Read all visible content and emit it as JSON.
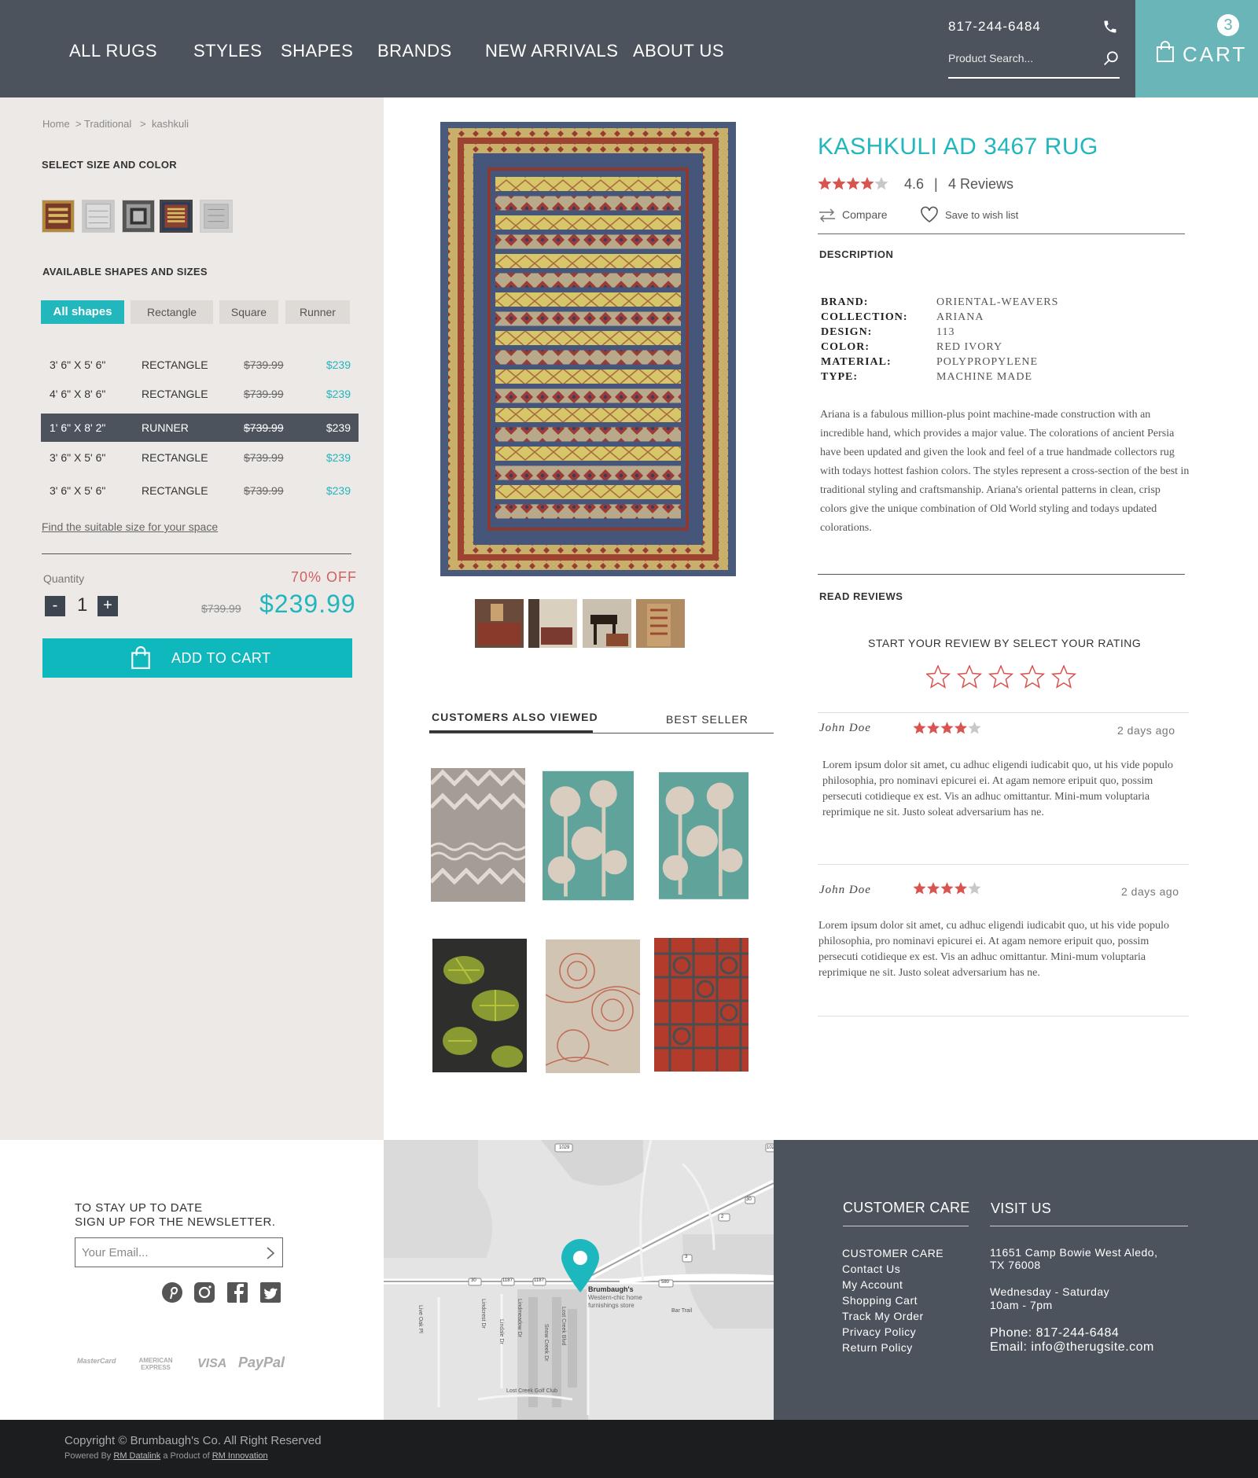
{
  "header": {
    "nav": [
      "ALL RUGS",
      "STYLES",
      "SHAPES",
      "BRANDS",
      "NEW ARRIVALS",
      "ABOUT US"
    ],
    "phone": "817-244-6484",
    "search_placeholder": "Product Search...",
    "cart_label": "CART",
    "cart_count": "3"
  },
  "breadcrumb": {
    "home": "Home",
    "sep1": ">",
    "category": "Traditional",
    "sep2": ">",
    "current": "kashkuli"
  },
  "sidebar": {
    "size_color_title": "SELECT SIZE AND COLOR",
    "shapes_title": "AVAILABLE SHAPES AND SIZES",
    "shape_filters": [
      "All shapes",
      "Rectangle",
      "Square",
      "Runner"
    ],
    "sizes": [
      {
        "size": "3' 6\" X 5' 6\"",
        "shape": "RECTANGLE",
        "old": "$739.99",
        "price": "$239"
      },
      {
        "size": "4' 6\" X 8' 6\"",
        "shape": "RECTANGLE",
        "old": "$739.99",
        "price": "$239"
      },
      {
        "size": "1' 6\" X 8' 2\"",
        "shape": "RUNNER",
        "old": "$739.99",
        "price": "$239"
      },
      {
        "size": "3' 6\" X 5' 6\"",
        "shape": "RECTANGLE",
        "old": "$739.99",
        "price": "$239"
      },
      {
        "size": "3' 6\" X 5' 6\"",
        "shape": "RECTANGLE",
        "old": "$739.99",
        "price": "$239"
      }
    ],
    "find_size": "Find the suitable size for your space",
    "quantity_label": "Quantity",
    "discount": "70% OFF",
    "qty_minus": "-",
    "qty_value": "1",
    "qty_plus": "+",
    "old_price": "$739.99",
    "price": "$239.99",
    "add_to_cart": "ADD TO CART"
  },
  "gallery_tabs": [
    "CUSTOMERS ALSO VIEWED",
    "BEST SELLER"
  ],
  "product": {
    "title": "KASHKULI AD 3467 RUG",
    "rating": "4.6",
    "rating_sep": "|",
    "review_count": "4 Reviews",
    "compare": "Compare",
    "wishlist": "Save to wish list",
    "description_title": "DESCRIPTION",
    "specs": [
      {
        "label": "BRAND:",
        "value": "ORIENTAL-WEAVERS"
      },
      {
        "label": "COLLECTION:",
        "value": "ARIANA"
      },
      {
        "label": "DESIGN:",
        "value": "113"
      },
      {
        "label": "COLOR:",
        "value": "RED IVORY"
      },
      {
        "label": "MATERIAL:",
        "value": "POLYPROPYLENE"
      },
      {
        "label": "TYPE:",
        "value": "MACHINE MADE"
      }
    ],
    "description": "Ariana is a fabulous million-plus point machine-made construction with an incredible hand, which provides a major value. The colorations of ancient Persia have been updated and given the look and feel of a true handmade collectors rug with todays hottest fashion colors. The styles represent a cross-section of the best in traditional styling and craftsmanship. Ariana's oriental patterns in clean, crisp colors give the unique combination of Old World styling and todays updated colorations."
  },
  "reviews": {
    "title": "READ REVIEWS",
    "prompt": "START YOUR REVIEW BY SELECT YOUR RATING",
    "items": [
      {
        "name": "John Doe",
        "stars": 4,
        "date": "2 days ago",
        "text": "Lorem ipsum dolor sit amet, cu adhuc eligendi iudicabit quo, ut his vide populo philosophia, pro nominavi epicurei ei. At agam nemore eripuit quo, possim persecuti cotidieque ex est. Vis an adhuc omittantur. Mini-mum voluptaria reprimique ne sit. Justo soleat adversarium has ne."
      },
      {
        "name": "John Doe",
        "stars": 4,
        "date": "2 days ago",
        "text": "Lorem ipsum dolor sit amet, cu adhuc eligendi iudicabit quo, ut his vide populo philosophia, pro nominavi epicurei ei. At agam nemore eripuit quo, possim persecuti cotidieque ex est. Vis an adhuc omittantur. Mini-mum voluptaria reprimique ne sit. Justo soleat adversarium has ne."
      }
    ]
  },
  "footer": {
    "newsletter_line1": "TO STAY UP TO DATE",
    "newsletter_line2": "SIGN UP FOR THE NEWSLETTER.",
    "email_placeholder": "Your Email...",
    "social": [
      "pinterest-icon",
      "instagram-icon",
      "facebook-icon",
      "twitter-icon"
    ],
    "payments": [
      "MasterCard",
      "AMERICAN EXPRESS",
      "VISA",
      "PayPal"
    ],
    "map": {
      "pin_label_title": "Brumbaugh's",
      "pin_label_sub1": "Western-chic home",
      "pin_label_sub2": "furnishings store",
      "streets": [
        "Live Oak Pl",
        "Lindcrest Dr",
        "Lindale Dr",
        "Lindmeadow Dr",
        "Snow Creek Dr",
        "Lost Creek Blvd",
        "Bar Trail",
        "Lost Creek Golf Club"
      ],
      "shields": [
        "1029",
        "30",
        "1187",
        "580",
        "30",
        "1187",
        "2",
        "3",
        "1029"
      ]
    },
    "care_title": "CUSTOMER CARE",
    "care_links": [
      "CUSTOMER CARE",
      "Contact Us",
      "My Account",
      "Shopping Cart",
      "Track My Order",
      "Privacy Policy",
      "Return Policy"
    ],
    "visit_title": "VISIT US",
    "address1": "11651 Camp Bowie West Aledo,",
    "address2": "TX 76008",
    "hours1": "Wednesday - Saturday",
    "hours2": "10am - 7pm",
    "phone": "Phone: 817-244-6484",
    "email": "Email:  info@therugsite.com",
    "copyright": "Copyright © Brumbaugh's Co. All Right Reserved",
    "powered_prefix": "Powered By",
    "powered_by": "RM Datalink",
    "powered_mid": "a Product of",
    "powered_company": "RM Innovation"
  },
  "colors": {
    "accent": "#22b6bd",
    "header": "#4c535c",
    "cart": "#6ab5b7",
    "star": "#d9534f"
  }
}
